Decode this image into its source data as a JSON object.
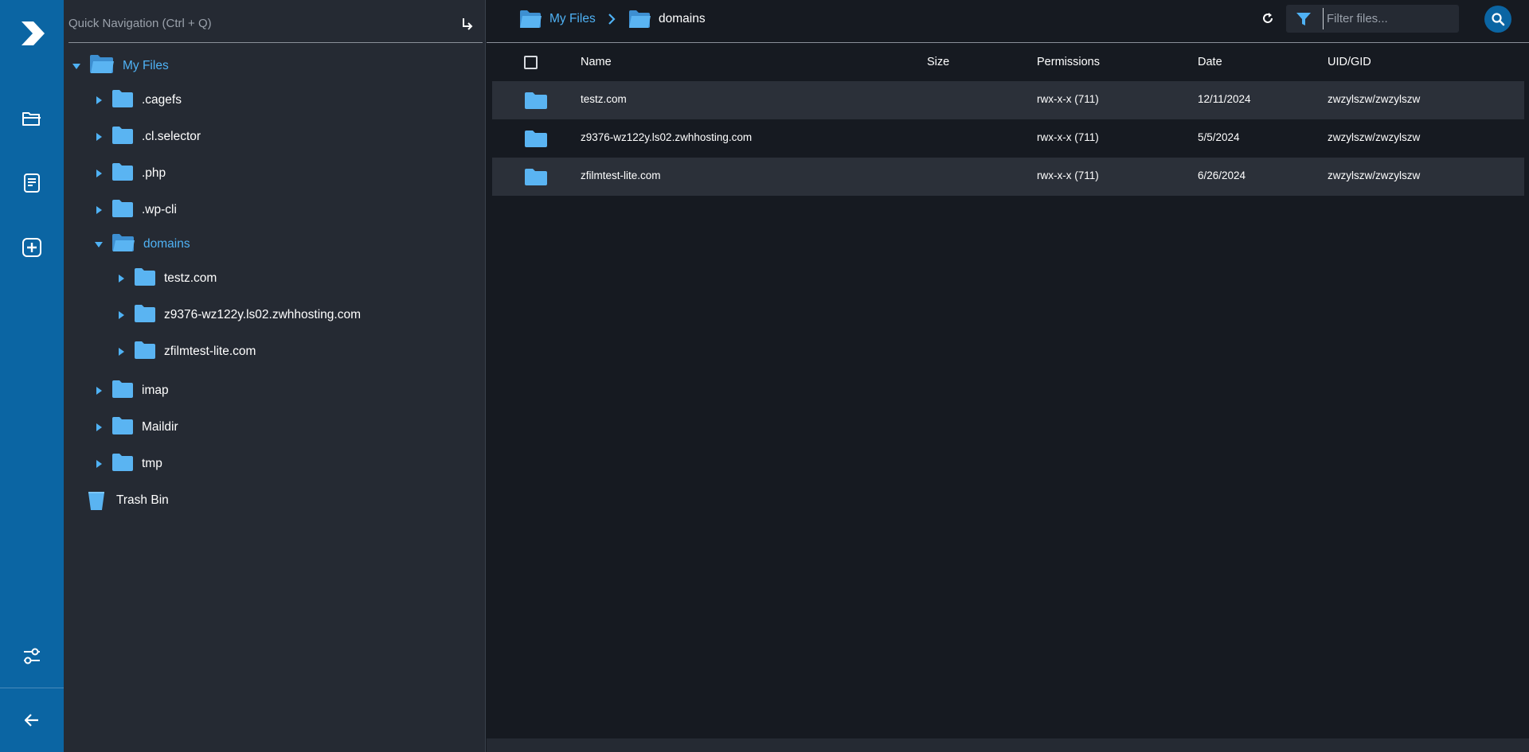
{
  "quick_nav": {
    "placeholder": "Quick Navigation (Ctrl + Q)"
  },
  "tree": {
    "root": {
      "label": "My Files"
    },
    "items": [
      {
        "label": ".cagefs"
      },
      {
        "label": ".cl.selector"
      },
      {
        "label": ".php"
      },
      {
        "label": ".wp-cli"
      },
      {
        "label": "domains"
      },
      {
        "label": "testz.com"
      },
      {
        "label": "z9376-wz122y.ls02.zwhhosting.com"
      },
      {
        "label": "zfilmtest-lite.com"
      },
      {
        "label": "imap"
      },
      {
        "label": "Maildir"
      },
      {
        "label": "tmp"
      }
    ],
    "trash": {
      "label": "Trash Bin"
    }
  },
  "breadcrumb": [
    {
      "label": "My Files"
    },
    {
      "label": "domains"
    }
  ],
  "filter": {
    "placeholder": "Filter files..."
  },
  "table": {
    "headers": {
      "name": "Name",
      "size": "Size",
      "permissions": "Permissions",
      "date": "Date",
      "uidgid": "UID/GID"
    },
    "rows": [
      {
        "name": "testz.com",
        "size": "",
        "permissions": "rwx-x-x (711)",
        "date": "12/11/2024",
        "uidgid": "zwzylszw/zwzylszw"
      },
      {
        "name": "z9376-wz122y.ls02.zwhhosting.com",
        "size": "",
        "permissions": "rwx-x-x (711)",
        "date": "5/5/2024",
        "uidgid": "zwzylszw/zwzylszw"
      },
      {
        "name": "zfilmtest-lite.com",
        "size": "",
        "permissions": "rwx-x-x (711)",
        "date": "6/26/2024",
        "uidgid": "zwzylszw/zwzylszw"
      }
    ]
  },
  "icons": {
    "rail": [
      "logo-icon",
      "folder-icon",
      "document-icon",
      "add-icon",
      "settings-sliders-icon",
      "back-arrow-icon"
    ],
    "toolbar": [
      "refresh-icon",
      "filter-icon",
      "search-icon"
    ]
  },
  "colors": {
    "rail": "#0b65a3",
    "tree_bg": "#252a33",
    "main_bg": "#161a21",
    "accent": "#4fb2f5",
    "folder": "#5ab4f2",
    "trash_delete": "#e8561f"
  }
}
